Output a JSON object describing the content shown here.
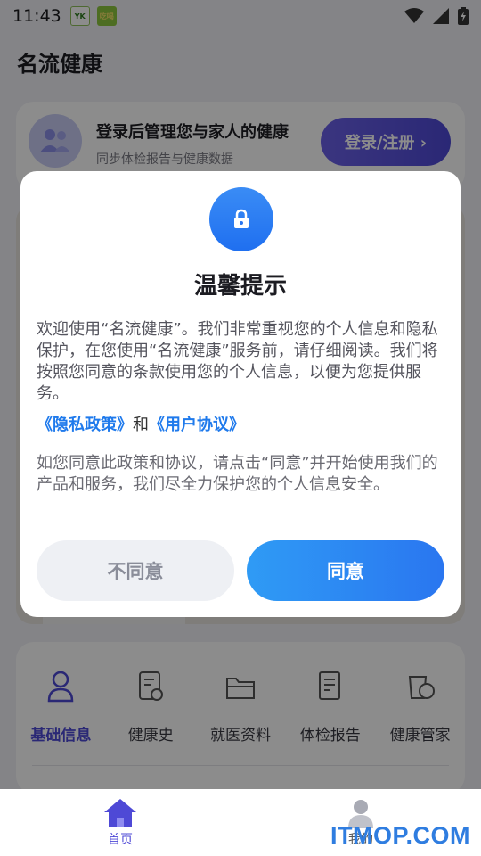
{
  "status_bar": {
    "time": "11:43",
    "notif1": "YK",
    "notif2": "吃喝"
  },
  "app": {
    "title": "名流健康"
  },
  "login_card": {
    "title": "登录后管理您与家人的健康",
    "subtitle": "同步体检报告与健康数据",
    "button": "登录/注册 ›"
  },
  "features": [
    {
      "label": "基础信息",
      "icon": "person-icon"
    },
    {
      "label": "健康史",
      "icon": "clipboard-icon"
    },
    {
      "label": "就医资料",
      "icon": "folder-icon"
    },
    {
      "label": "体检报告",
      "icon": "report-icon"
    },
    {
      "label": "健康管家",
      "icon": "chat-cup-icon"
    }
  ],
  "tabs": [
    {
      "label": "首页",
      "icon": "home-icon"
    },
    {
      "label": "我的",
      "icon": "user-icon"
    }
  ],
  "watermark": "ITMOP.COM",
  "dialog": {
    "title": "温馨提示",
    "paragraph1": "欢迎使用“名流健康”。我们非常重视您的个人信息和隐私保护，在您使用“名流健康”服务前，请仔细阅读。我们将按照您同意的条款使用您的个人信息，以便为您提供服务。",
    "privacy_link": "《隐私政策》",
    "and": "和",
    "agreement_link": "《用户协议》",
    "paragraph2": "如您同意此政策和协议，请点击“同意”并开始使用我们的产品和服务，我们尽全力保护您的个人信息安全。",
    "disagree": "不同意",
    "agree": "同意"
  },
  "colors": {
    "accent": "#4e49d6",
    "primary_blue": "#2a76f0",
    "link_blue": "#1f7aec"
  }
}
